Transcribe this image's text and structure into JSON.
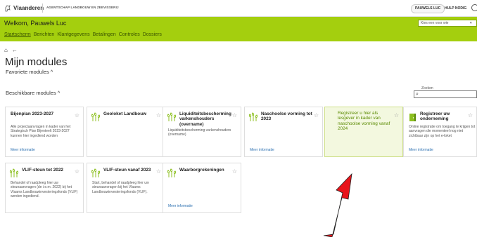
{
  "topbar": {
    "brand": "Vlaanderen",
    "agency": "AGENTSCHAP LANDBOUW EN ZEEVISSERIJ",
    "user_button": "PAUWELS LUC",
    "help": "HULP NODIG"
  },
  "header": {
    "welcome": "Welkom, Pauwels Luc",
    "search_placeholder": "Kies een voor wie",
    "nav": [
      "Startscherm",
      "Berichten",
      "Klantgegevens",
      "Betalingen",
      "Controles",
      "Dossiers"
    ]
  },
  "main": {
    "title": "Mijn modules",
    "favorites": "Favoriete modules ^",
    "available": "Beschikbare modules ^",
    "search_label": "Zoeken"
  },
  "cards": [
    {
      "title": "Bijenplan 2023-2027",
      "desc": "Alle projectaanvragen in kader van het Strategisch Plan Bijenteelt 2023-2027 kunnen hier ingediend worden",
      "more": "Meer informatie"
    },
    {
      "title": "Geoloket Landbouw",
      "desc": "",
      "more": ""
    },
    {
      "title": "Liquiditeitsbescherming varkenshouders (overname)",
      "desc": "Liquiditeitsbescherming varkenshouders (overname)",
      "more": ""
    },
    {
      "title": "Naschoolse vorming tot 2023",
      "desc": "",
      "more": "Meer informatie"
    },
    {
      "title": "Registreer u hier als lesgever in kader van naschoolse vorming vanaf 2024",
      "desc": "",
      "more": ""
    },
    {
      "title": "Registreer uw onderneming",
      "desc": "Online registratie om toegang te krijgen tot aanvragen die momenteel nog niet zichtbaar zijn op het e-loket",
      "more": "Meer informatie"
    },
    {
      "title": "VLIF-steun tot 2022",
      "desc": "Behandel of raadpleeg hier uw steunaanvragen (de i.e.m. 2022) bij het Vlaams Landbouwinvesteringsfonds (VLIF) werden ingediend.",
      "more": ""
    },
    {
      "title": "VLIF-steun vanaf 2023",
      "desc": "Start, behandel of raadpleeg hier uw steunaanvragen bij het Vlaams Landbouwinvesteringsfonds (VLIF).",
      "more": ""
    },
    {
      "title": "Waarborgrekeningen",
      "desc": "",
      "more": "Meer informatie"
    }
  ],
  "colors": {
    "header_green": "#a4cf0e",
    "highlight_bg": "#f3f8df",
    "link_blue": "#2a6fb0",
    "arrow_red": "#e8141b"
  }
}
